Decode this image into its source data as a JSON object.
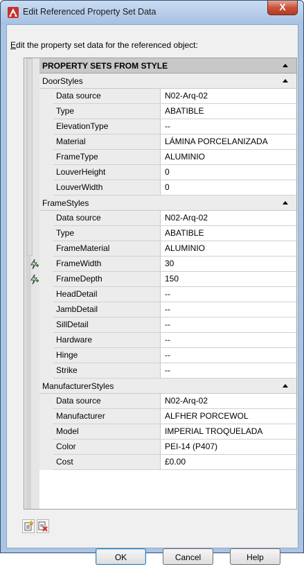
{
  "window": {
    "title": "Edit Referenced Property Set Data",
    "close_label": "X"
  },
  "instructions": {
    "mnemonic": "E",
    "rest": "dit the property set data for the referenced object:"
  },
  "grid": {
    "header": "PROPERTY SETS FROM STYLE",
    "sections": [
      {
        "name": "DoorStyles",
        "rows": [
          {
            "name": "Data source",
            "value": "N02-Arq-02",
            "editable": false
          },
          {
            "name": "Type",
            "value": "ABATIBLE",
            "editable": true
          },
          {
            "name": "ElevationType",
            "value": "--",
            "editable": true
          },
          {
            "name": "Material",
            "value": "LÁMINA PORCELANIZADA",
            "editable": true
          },
          {
            "name": "FrameType",
            "value": "ALUMINIO",
            "editable": true
          },
          {
            "name": "LouverHeight",
            "value": "0",
            "editable": true
          },
          {
            "name": "LouverWidth",
            "value": "0",
            "editable": true
          }
        ]
      },
      {
        "name": "FrameStyles",
        "rows": [
          {
            "name": "Data source",
            "value": "N02-Arq-02",
            "editable": false
          },
          {
            "name": "Type",
            "value": "ABATIBLE",
            "editable": false
          },
          {
            "name": "FrameMaterial",
            "value": "ALUMINIO",
            "editable": false
          },
          {
            "name": "FrameWidth",
            "value": "30",
            "editable": true,
            "override": true
          },
          {
            "name": "FrameDepth",
            "value": "150",
            "editable": true,
            "override": true
          },
          {
            "name": "HeadDetail",
            "value": "--",
            "editable": true
          },
          {
            "name": "JambDetail",
            "value": "--",
            "editable": true
          },
          {
            "name": "SillDetail",
            "value": "--",
            "editable": true
          },
          {
            "name": "Hardware",
            "value": "--",
            "editable": true
          },
          {
            "name": "Hinge",
            "value": "--",
            "editable": true
          },
          {
            "name": "Strike",
            "value": "--",
            "editable": true
          }
        ]
      },
      {
        "name": "ManufacturerStyles",
        "rows": [
          {
            "name": "Data source",
            "value": "N02-Arq-02",
            "editable": false
          },
          {
            "name": "Manufacturer",
            "value": "ALFHER PORCEWOL",
            "editable": true
          },
          {
            "name": "Model",
            "value": "IMPERIAL TROQUELADA",
            "editable": true
          },
          {
            "name": "Color",
            "value": "PEI-14 (P407)",
            "editable": true
          },
          {
            "name": "Cost",
            "value": "£0.00",
            "editable": true
          }
        ]
      }
    ]
  },
  "buttons": {
    "ok": "OK",
    "cancel": "Cancel",
    "help": "Help"
  },
  "icons": {
    "title": "autocad-icon",
    "add": "add-property-set-icon",
    "remove": "remove-property-set-icon",
    "override": "property-override-icon"
  }
}
